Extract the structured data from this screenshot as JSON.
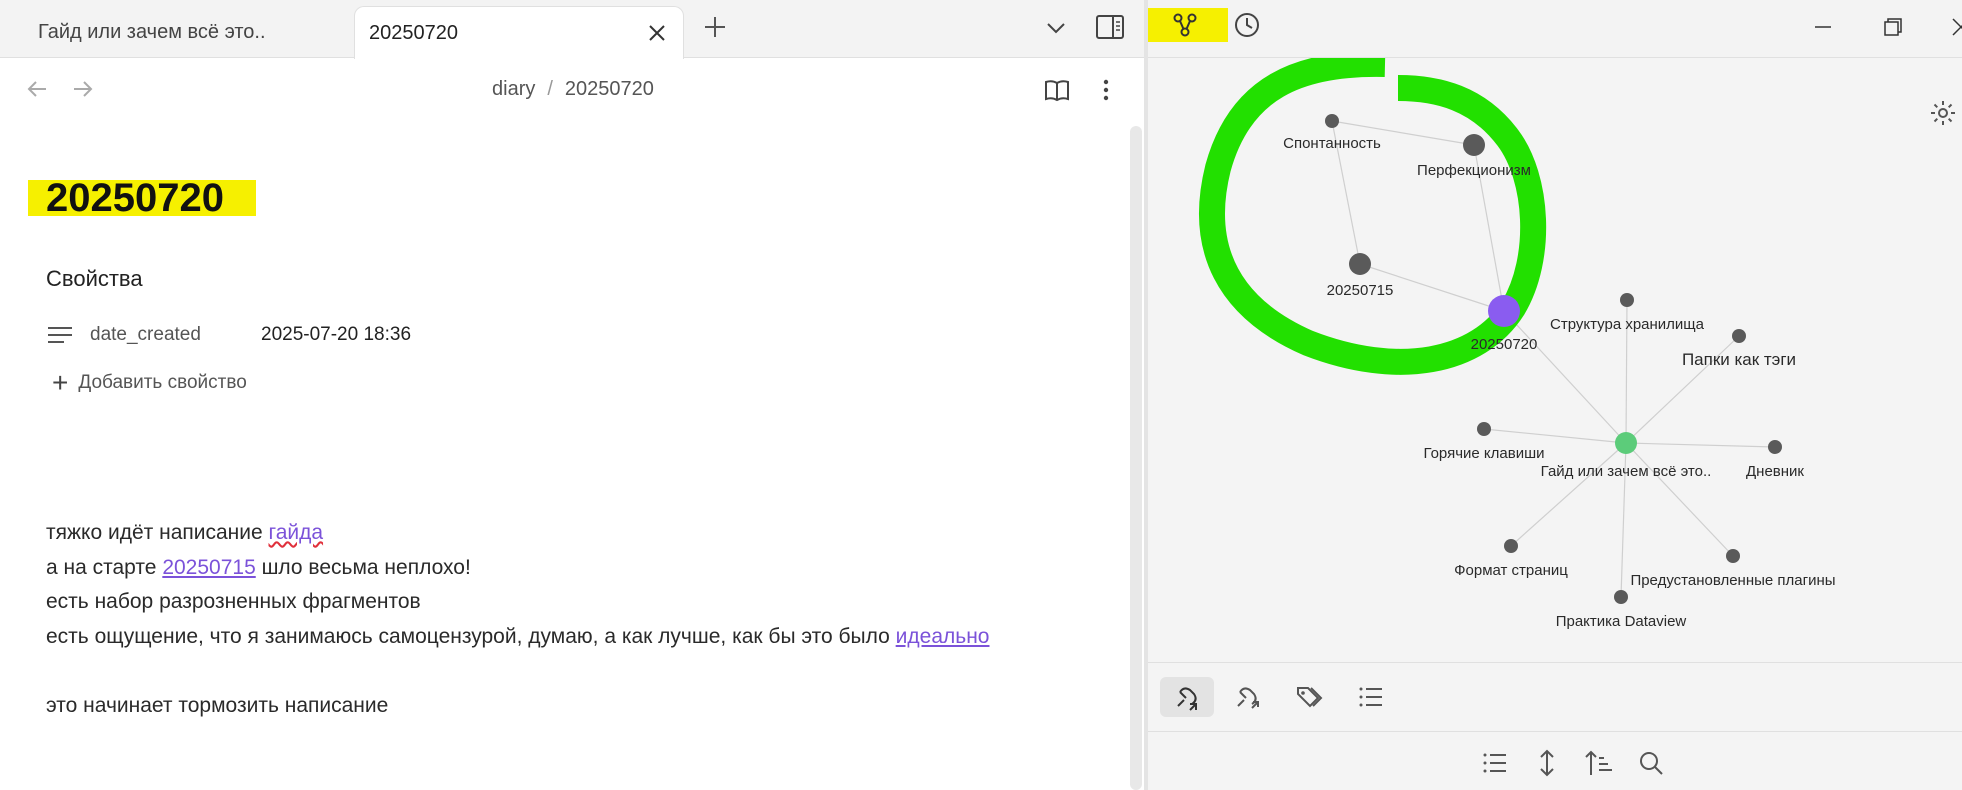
{
  "tabs": [
    {
      "label": "Гайд или зачем всё это..",
      "active": false
    },
    {
      "label": "20250720",
      "active": true
    }
  ],
  "breadcrumb": {
    "folder": "diary",
    "separator": "/",
    "file": "20250720"
  },
  "note": {
    "title": "20250720",
    "properties_heading": "Свойства",
    "property": {
      "key": "date_created",
      "value": "2025-07-20 18:36"
    },
    "add_property_label": "Добавить свойство",
    "body": {
      "l1_text": "тяжко идёт написание ",
      "l1_link": "гайда",
      "l2_text_a": "а на старте ",
      "l2_link": "20250715",
      "l2_text_b": " шло весьма неплохо!",
      "l3_text": "есть набор разрозненных фрагментов",
      "l4_text": "есть ощущение, что я занимаюсь самоцензурой, думаю, а как лучше, как бы это было ",
      "l4_link": "идеально",
      "l6_text": "это начинает тормозить написание"
    }
  },
  "graph": {
    "nodes": [
      {
        "id": "spont",
        "label": "Спонтанность",
        "size": "small",
        "color": "#5a5a5a"
      },
      {
        "id": "perf",
        "label": "Перфекционизм",
        "size": "medium",
        "color": "#5a5a5a"
      },
      {
        "id": "d0715",
        "label": "20250715",
        "size": "medium",
        "color": "#5a5a5a"
      },
      {
        "id": "d0720",
        "label": "20250720",
        "size": "large",
        "color": "#8a5cf0"
      },
      {
        "id": "struct",
        "label": "Структура хранилища",
        "size": "small",
        "color": "#5a5a5a"
      },
      {
        "id": "folders",
        "label": "Папки как тэги",
        "size": "small",
        "color": "#5a5a5a"
      },
      {
        "id": "hotkeys",
        "label": "Горячие клавиши",
        "size": "small",
        "color": "#5a5a5a"
      },
      {
        "id": "guide",
        "label": "Гайд или зачем всё это..",
        "size": "medium",
        "color": "#5ccc7a"
      },
      {
        "id": "diary",
        "label": "Дневник",
        "size": "small",
        "color": "#5a5a5a"
      },
      {
        "id": "format",
        "label": "Формат страниц",
        "size": "small",
        "color": "#5a5a5a"
      },
      {
        "id": "plugins",
        "label": "Предустановленные плагины",
        "size": "small",
        "color": "#5a5a5a"
      },
      {
        "id": "dataview",
        "label": "Практика Dataview",
        "size": "small",
        "color": "#5a5a5a"
      }
    ],
    "edges": [
      [
        "spont",
        "perf"
      ],
      [
        "spont",
        "d0715"
      ],
      [
        "perf",
        "d0720"
      ],
      [
        "d0715",
        "d0720"
      ],
      [
        "d0720",
        "guide"
      ],
      [
        "struct",
        "guide"
      ],
      [
        "folders",
        "guide"
      ],
      [
        "hotkeys",
        "guide"
      ],
      [
        "diary",
        "guide"
      ],
      [
        "format",
        "guide"
      ],
      [
        "plugins",
        "guide"
      ],
      [
        "dataview",
        "guide"
      ]
    ],
    "annotation_color": "#22e000"
  },
  "colors": {
    "highlight": "#f6f000",
    "link": "#7b52d9",
    "active_node": "#8a5cf0",
    "guide_node": "#5ccc7a"
  },
  "icons": {
    "graph": "graph-icon",
    "recent": "clock-icon",
    "backlinks": "backlinks-icon",
    "outlinks": "outgoing-links-icon",
    "tags": "tags-icon",
    "outline": "outline-icon"
  }
}
